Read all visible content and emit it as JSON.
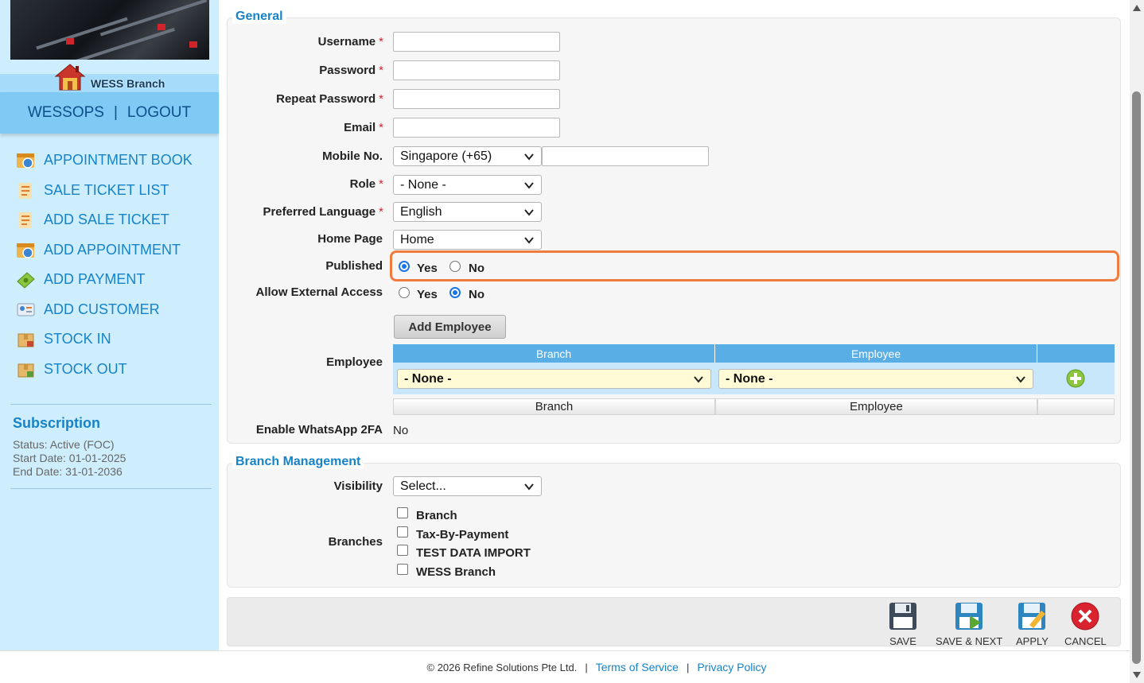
{
  "sidebar": {
    "branch_name": "WESS Branch",
    "user": "WESSOPS",
    "separator": "|",
    "logout": "LOGOUT",
    "menu": [
      {
        "label": "APPOINTMENT BOOK",
        "icon": "calendar-icon"
      },
      {
        "label": "SALE TICKET LIST",
        "icon": "ticket-list-icon"
      },
      {
        "label": "ADD SALE TICKET",
        "icon": "ticket-add-icon"
      },
      {
        "label": "ADD APPOINTMENT",
        "icon": "calendar-add-icon"
      },
      {
        "label": "ADD PAYMENT",
        "icon": "money-icon"
      },
      {
        "label": "ADD CUSTOMER",
        "icon": "customer-card-icon"
      },
      {
        "label": "STOCK IN",
        "icon": "box-in-icon"
      },
      {
        "label": "STOCK OUT",
        "icon": "box-out-icon"
      }
    ],
    "subscription": {
      "title": "Subscription",
      "status": "Status: Active (FOC)",
      "start": "Start Date: 01-01-2025",
      "end": "End Date: 31-01-2036"
    }
  },
  "general": {
    "legend": "General",
    "username_label": "Username",
    "password_label": "Password",
    "repeat_password_label": "Repeat Password",
    "email_label": "Email",
    "required_mark": "*",
    "username_value": "",
    "password_value": "",
    "repeat_password_value": "",
    "email_value": "",
    "mobile_label": "Mobile No.",
    "mobile_country": "Singapore (+65)",
    "mobile_value": "",
    "role_label": "Role",
    "role_value": "- None -",
    "language_label": "Preferred Language",
    "language_value": "English",
    "homepage_label": "Home Page",
    "homepage_value": "Home",
    "published_label": "Published",
    "published_yes": "Yes",
    "published_no": "No",
    "published_selected": "Yes",
    "external_label": "Allow External Access",
    "external_yes": "Yes",
    "external_no": "No",
    "external_selected": "No",
    "add_employee_button": "Add Employee",
    "employee_label": "Employee",
    "employee_table": {
      "headers": [
        "Branch",
        "Employee"
      ],
      "branch_select": "- None -",
      "employee_select": "- None -",
      "footers": [
        "Branch",
        "Employee"
      ]
    },
    "whatsapp_label": "Enable WhatsApp 2FA",
    "whatsapp_value": "No"
  },
  "branch_management": {
    "legend": "Branch Management",
    "visibility_label": "Visibility",
    "visibility_value": "Select...",
    "branches_label": "Branches",
    "branches": [
      "Branch",
      "Tax-By-Payment",
      "TEST DATA IMPORT",
      "WESS Branch"
    ]
  },
  "toolbar": {
    "save": "SAVE",
    "save_next": "SAVE & NEXT",
    "apply": "APPLY",
    "cancel": "CANCEL"
  },
  "footer": {
    "copyright": "© 2026 Refine Solutions Pte Ltd.",
    "divider": "|",
    "terms": "Terms of Service",
    "privacy": "Privacy Policy"
  },
  "colors": {
    "accent": "#1683c8",
    "sidebar_bg": "#cfeefd",
    "highlight": "#f07b3f"
  }
}
